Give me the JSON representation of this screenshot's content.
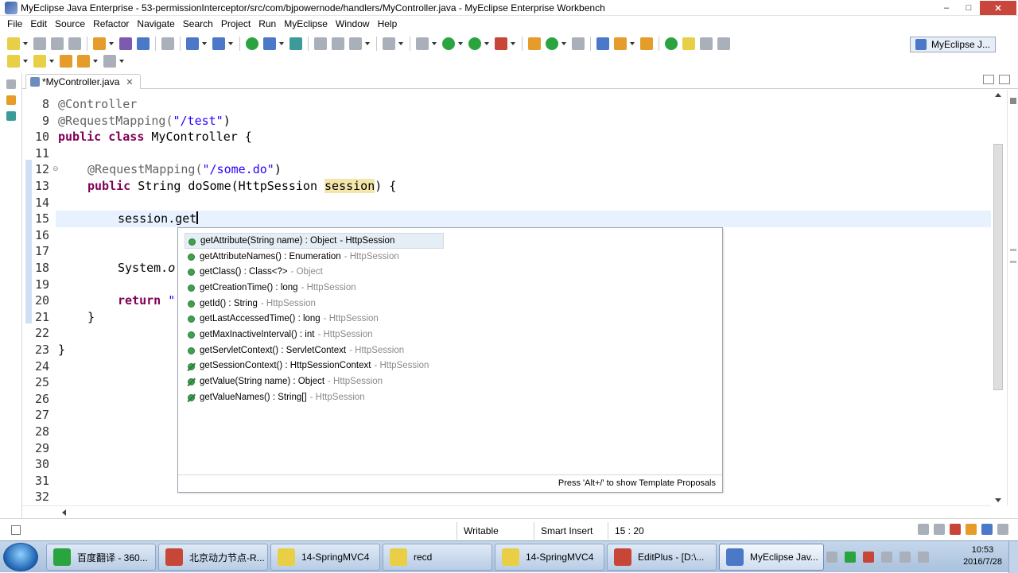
{
  "window": {
    "title": "MyEclipse Java Enterprise - 53-permissionInterceptor/src/com/bjpowernode/handlers/MyController.java - MyEclipse Enterprise Workbench",
    "minimize": "–",
    "maximize": "□",
    "close": "✕"
  },
  "menu": [
    "File",
    "Edit",
    "Source",
    "Refactor",
    "Navigate",
    "Search",
    "Project",
    "Run",
    "MyEclipse",
    "Window",
    "Help"
  ],
  "perspective": {
    "label": "MyEclipse J..."
  },
  "editor_tab": {
    "label": "*MyController.java",
    "close": "✕"
  },
  "code": {
    "line_numbers": [
      "8",
      "9",
      "10",
      "11",
      "12",
      "13",
      "14",
      "15",
      "16",
      "17",
      "18",
      "19",
      "20",
      "21",
      "22",
      "23",
      "24",
      "25",
      "26",
      "27",
      "28",
      "29",
      "30",
      "31",
      "32"
    ],
    "l8_ann": "@Controller",
    "l9_ann": "@RequestMapping(",
    "l9_str": "\"/test\"",
    "l9_end": ")",
    "l10_kw1": "public",
    "l10_kw2": "class",
    "l10_rest": " MyController {",
    "l12_ann": "@RequestMapping(",
    "l12_str": "\"/some.do\"",
    "l12_end": ")",
    "l13_kw": "public",
    "l13_mid": " String doSome(HttpSession ",
    "l13_param": "session",
    "l13_end": ") {",
    "l15_text": "session.get",
    "l18_text": "System.",
    "l18_italic": "o",
    "l20_kw": "return",
    "l20_str": " \"",
    "l21_text": "}",
    "l23_text": "}"
  },
  "content_assist": {
    "items": [
      {
        "sig": "getAttribute(String name) : Object",
        "owner": "- HttpSession",
        "deprecated": false
      },
      {
        "sig": "getAttributeNames() : Enumeration",
        "owner": "- HttpSession",
        "deprecated": false
      },
      {
        "sig": "getClass() : Class<?>",
        "owner": "- Object",
        "deprecated": false
      },
      {
        "sig": "getCreationTime() : long",
        "owner": "- HttpSession",
        "deprecated": false
      },
      {
        "sig": "getId() : String",
        "owner": "- HttpSession",
        "deprecated": false
      },
      {
        "sig": "getLastAccessedTime() : long",
        "owner": "- HttpSession",
        "deprecated": false
      },
      {
        "sig": "getMaxInactiveInterval() : int",
        "owner": "- HttpSession",
        "deprecated": false
      },
      {
        "sig": "getServletContext() : ServletContext",
        "owner": "- HttpSession",
        "deprecated": false
      },
      {
        "sig": "getSessionContext() : HttpSessionContext",
        "owner": "- HttpSession",
        "deprecated": true
      },
      {
        "sig": "getValue(String name) : Object",
        "owner": "- HttpSession",
        "deprecated": true
      },
      {
        "sig": "getValueNames() : String[]",
        "owner": "- HttpSession",
        "deprecated": true
      }
    ],
    "footer": "Press 'Alt+/' to show Template Proposals"
  },
  "status": {
    "writable": "Writable",
    "insert_mode": "Smart Insert",
    "position": "15 : 20"
  },
  "taskbar": {
    "buttons": [
      "百度翻译 - 360...",
      "北京动力节点-R...",
      "14-SpringMVC4",
      "recd",
      "14-SpringMVC4",
      "EditPlus - [D:\\...",
      "MyEclipse Jav..."
    ],
    "time": "10:53",
    "date": "2016/7/28"
  }
}
